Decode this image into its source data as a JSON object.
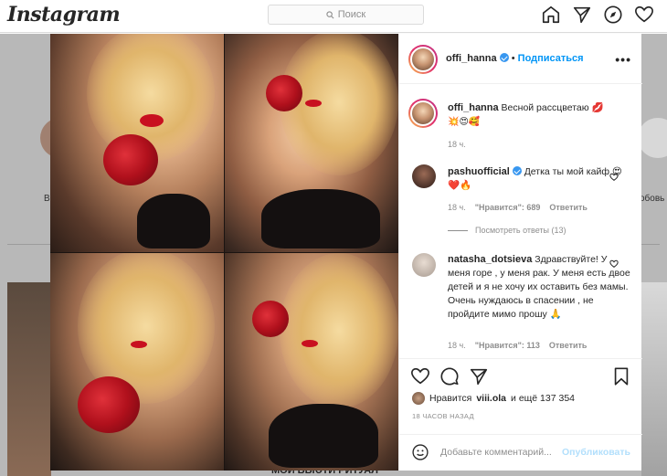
{
  "app": {
    "logo": "Instagram",
    "search_placeholder": "Поиск"
  },
  "nav": {
    "icons": [
      "home-icon",
      "direct-icon",
      "explore-icon",
      "activity-icon"
    ]
  },
  "background": {
    "story_label_left": "В",
    "story_label_right": "обовь",
    "bottom_banner": "МОЙ БЬЮТИ РИТУАЛ"
  },
  "post": {
    "author": "offi_hanna",
    "follow_label": "Подписаться",
    "caption_username": "offi_hanna",
    "caption_text": "Весной рассцветаю 💋",
    "caption_emoji": "💥😍🥰",
    "caption_time": "18 ч.",
    "comments": [
      {
        "username": "pashuofficial",
        "verified": true,
        "text": "Детка ты мой кайф 😍❤️🔥",
        "time": "18 ч.",
        "likes": "\"Нравится\": 689",
        "reply": "Ответить",
        "view_replies": "Посмотреть ответы (13)"
      },
      {
        "username": "natasha_dotsieva",
        "verified": false,
        "text": "Здравствуйте! У меня горе , у меня рак. У меня есть двое детей и я не хочу их оставить без мамы. Очень нуждаюсь в спасении , не пройдите мимо прошу 🙏",
        "time": "18 ч.",
        "likes": "\"Нравится\": 113",
        "reply": "Ответить"
      }
    ],
    "likes_prefix": "Нравится",
    "likes_user": "viii.ola",
    "likes_suffix": "и ещё 137 354",
    "time_ago": "18 ЧАСОВ НАЗАД",
    "add_comment_placeholder": "Добавьте комментарий...",
    "post_button": "Опубликовать"
  },
  "colors": {
    "link_blue": "#0095f6",
    "verified_blue": "#3897f0",
    "post_disabled": "#b2dffc"
  }
}
